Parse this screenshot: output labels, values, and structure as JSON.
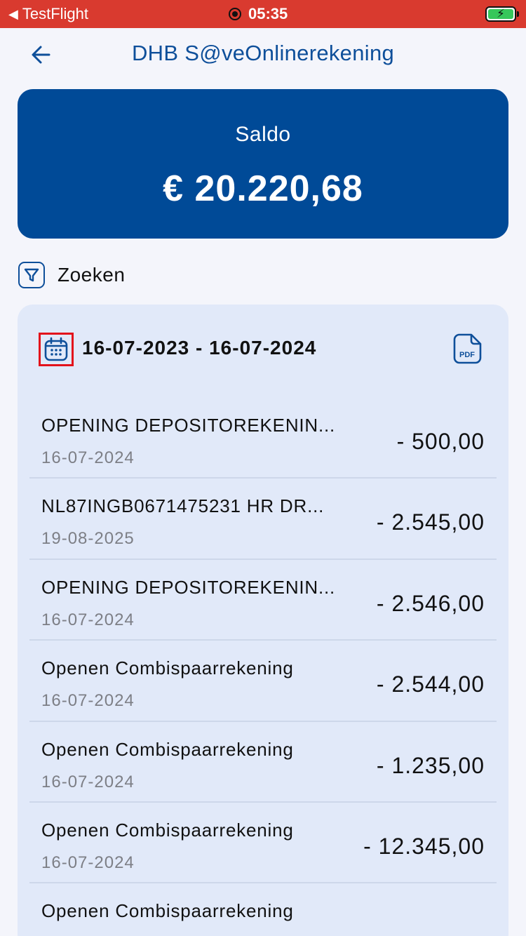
{
  "status_bar": {
    "back_app": "TestFlight",
    "time": "05:35"
  },
  "header": {
    "title": "DHB S@veOnlinerekening"
  },
  "balance": {
    "label": "Saldo",
    "value": "€  20.220,68"
  },
  "search": {
    "label": "Zoeken"
  },
  "transactions": {
    "date_range": "16-07-2023 - 16-07-2024",
    "pdf_label": "PDF",
    "items": [
      {
        "description": "OPENING DEPOSITOREKENIN...",
        "date": "16-07-2024",
        "amount": "- 500,00"
      },
      {
        "description": "NL87INGB0671475231 HR DR...",
        "date": "19-08-2025",
        "amount": "- 2.545,00"
      },
      {
        "description": "OPENING DEPOSITOREKENIN...",
        "date": "16-07-2024",
        "amount": "- 2.546,00"
      },
      {
        "description": "Openen Combispaarrekening",
        "date": "16-07-2024",
        "amount": "- 2.544,00"
      },
      {
        "description": "Openen Combispaarrekening",
        "date": "16-07-2024",
        "amount": "- 1.235,00"
      },
      {
        "description": "Openen Combispaarrekening",
        "date": "16-07-2024",
        "amount": "- 12.345,00"
      },
      {
        "description": "Openen Combispaarrekening",
        "date": "",
        "amount": ""
      }
    ]
  },
  "colors": {
    "status_bar": "#d93a2f",
    "brand_blue": "#004a97",
    "panel": "#e1e9f9",
    "highlight": "#e3121b"
  },
  "icons": {
    "back": "arrow-left-icon",
    "filter": "filter-icon",
    "calendar": "calendar-icon",
    "pdf": "pdf-document-icon"
  }
}
